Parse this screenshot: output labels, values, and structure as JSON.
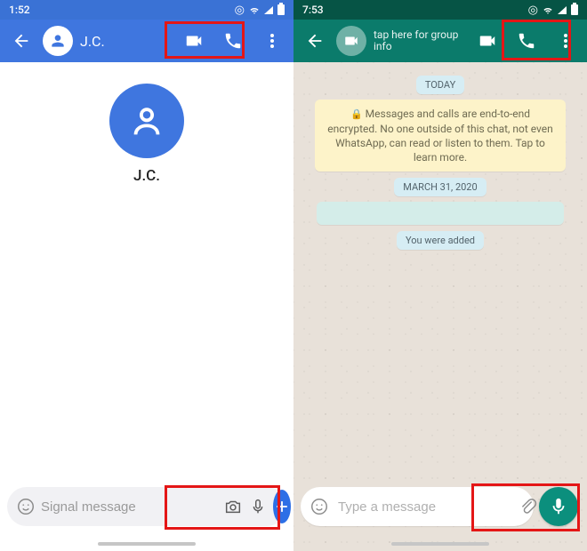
{
  "left": {
    "status_time": "1:52",
    "header": {
      "contact_name": "J.C."
    },
    "center_name": "J.C.",
    "input_placeholder": "Signal message"
  },
  "right": {
    "status_time": "7:53",
    "header": {
      "subtitle": "tap here for group info"
    },
    "today_pill": "TODAY",
    "e2e_text": "Messages and calls are end-to-end encrypted. No one outside of this chat, not even WhatsApp, can read or listen to them. Tap to learn more.",
    "date_pill": "MARCH 31, 2020",
    "added_pill": "You were added",
    "input_placeholder": "Type a message"
  }
}
